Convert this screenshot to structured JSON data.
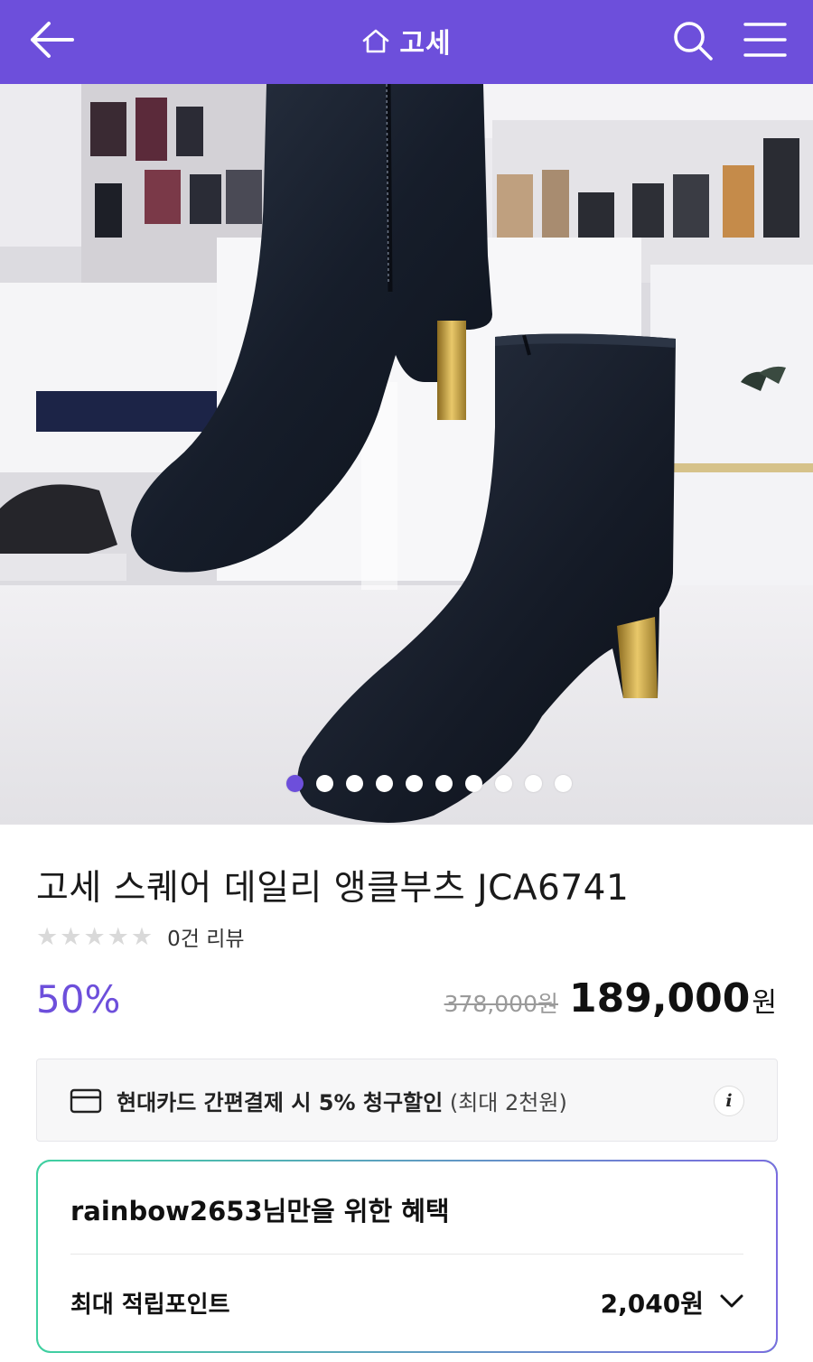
{
  "header": {
    "title": "고세",
    "icons": [
      "arrow-left-icon",
      "home-icon",
      "search-icon",
      "hamburger-menu-icon"
    ],
    "background": "#6d4fdb"
  },
  "gallery": {
    "total_images": 10,
    "active_index": 0
  },
  "product": {
    "title": "고세 스퀘어 데일리 앵클부츠 JCA6741",
    "rating_stars": 0,
    "review_text": "0건 리뷰",
    "discount": "50%",
    "original_price": "378,000원",
    "sale_price": "189,000",
    "sale_unit": "원"
  },
  "promo": {
    "bold_text": "현대카드 간편결제 시 5% 청구할인",
    "sub_text": "(최대 2천원)",
    "info_label": "i"
  },
  "benefit": {
    "user": "rainbow2653",
    "title_suffix": "님만을 위한 혜택",
    "points_label": "최대 적립포인트",
    "points_value": "2,040원"
  },
  "colors": {
    "accent": "#6d4fdb",
    "benefit_border_start": "#3fd1a0",
    "benefit_border_end": "#7b6be0"
  }
}
